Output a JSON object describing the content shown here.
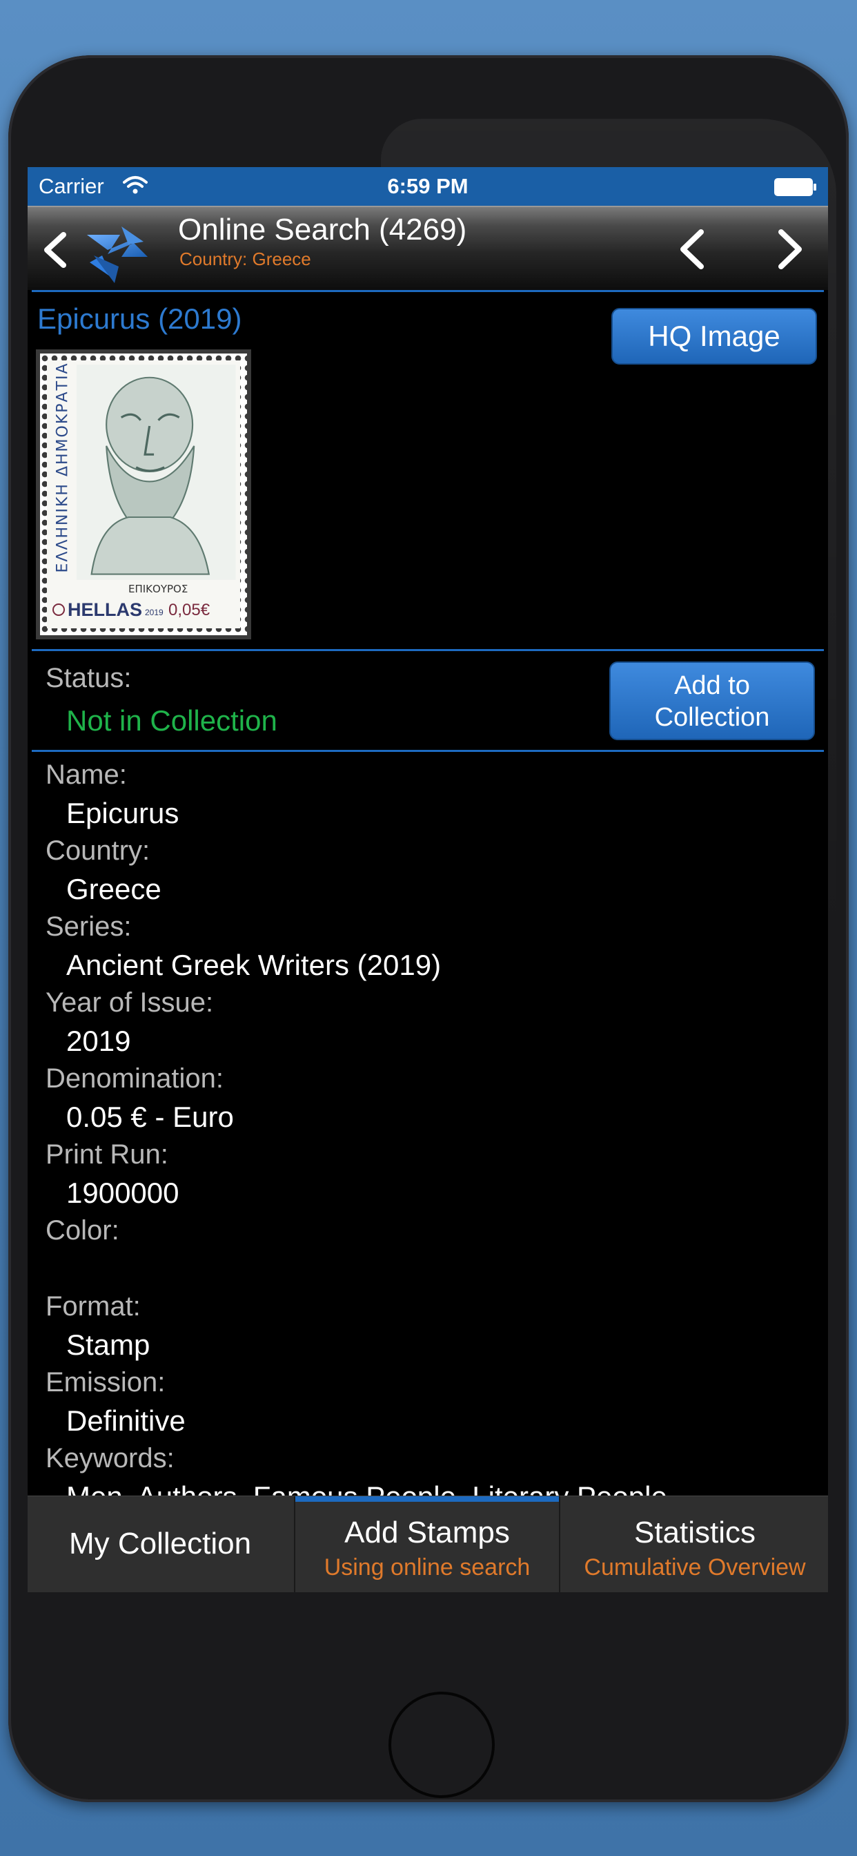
{
  "status_bar": {
    "carrier": "Carrier",
    "time": "6:59 PM"
  },
  "nav": {
    "title": "Online Search (4269)",
    "subtitle": "Country: Greece"
  },
  "stamp": {
    "title": "Epicurus (2019)",
    "hq_button": "HQ Image",
    "image": {
      "vertical_text": "ΕΛΛΗΝΙΚΗ ΔΗΜΟΚΡΑΤΙΑ",
      "caption": "ΕΠΙΚΟΥΡΟΣ",
      "country": "HELLAS",
      "year": "2019",
      "face_value": "0,05€"
    }
  },
  "status": {
    "label": "Status:",
    "value": "Not in Collection",
    "add_button_line1": "Add to",
    "add_button_line2": "Collection"
  },
  "details": [
    {
      "label": "Name:",
      "value": "Epicurus"
    },
    {
      "label": "Country:",
      "value": "Greece"
    },
    {
      "label": "Series:",
      "value": "Ancient Greek Writers (2019)"
    },
    {
      "label": "Year of Issue:",
      "value": "2019"
    },
    {
      "label": "Denomination:",
      "value": "0.05 € - Euro"
    },
    {
      "label": "Print Run:",
      "value": "1900000"
    },
    {
      "label": "Color:",
      "value": ""
    },
    {
      "label": "Format:",
      "value": "Stamp"
    },
    {
      "label": "Emission:",
      "value": "Definitive"
    },
    {
      "label": "Keywords:",
      "value": "Men, Authors, Famous People, Literary People"
    }
  ],
  "tabs": [
    {
      "label": "My Collection",
      "sub": ""
    },
    {
      "label": "Add Stamps",
      "sub": "Using online search",
      "active": true
    },
    {
      "label": "Statistics",
      "sub": "Cumulative Overview"
    }
  ],
  "colors": {
    "accent": "#1d6ac0",
    "status_green": "#1fb34a",
    "orange": "#e07a2b",
    "status_bar": "#1a5fa6"
  },
  "icons": {
    "wifi": "wifi-icon",
    "battery": "battery-icon",
    "back": "chevron-left-icon",
    "prev": "chevron-left-icon",
    "next": "chevron-right-icon",
    "logo": "app-logo"
  }
}
